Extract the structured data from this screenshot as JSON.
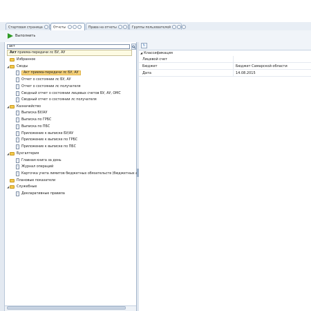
{
  "tabs": [
    {
      "label": "Стартовая страница"
    },
    {
      "label": "Отчеты"
    },
    {
      "label": "Права на отчеты"
    },
    {
      "label": "Группы пользователей"
    }
  ],
  "toolbar": {
    "run_label": "Выполнить"
  },
  "search": {
    "value": "акт"
  },
  "suggestion": {
    "bold": "Акт",
    "rest": "приема-передачи лс БУ, АУ"
  },
  "tree": {
    "favorites": "Избранное",
    "svody": "Своды",
    "svody_items": [
      "Акт приема-передачи лс БУ, АУ",
      "Отчет о состоянии лс БУ, АУ",
      "Отчет о состоянии лс получателя",
      "Сводный отчет о состоянии лицевых счетов БУ, АУ, ОМС",
      "Сводный отчет о состоянии лс получателя"
    ],
    "kaznach": "Казначейство",
    "kaznach_items": [
      "Выписка БУ/АУ",
      "Выписка по ГРБС",
      "Выписка по ПБС",
      "Приложение к выписке БУ/АУ",
      "Приложение к выписке по ГРБС",
      "Приложение к выписке по ПБС"
    ],
    "buh": "Бухгалтерия",
    "buh_items": [
      "Главная книга за день",
      "Журнал операций",
      "Карточка учета лимитов бюджетных обязательств (бюджетных ассигнований)"
    ],
    "plan": "Плановые показатели",
    "serv": "Служебные",
    "serv_items": [
      "Декларативные правила"
    ]
  },
  "right": {
    "group": "Классификация",
    "props": [
      {
        "name": "Лицевой счет",
        "value": ""
      },
      {
        "name": "Бюджет",
        "value": "Бюджет Самарской области"
      },
      {
        "name": "Дата",
        "value": "14.08.2015"
      }
    ]
  }
}
